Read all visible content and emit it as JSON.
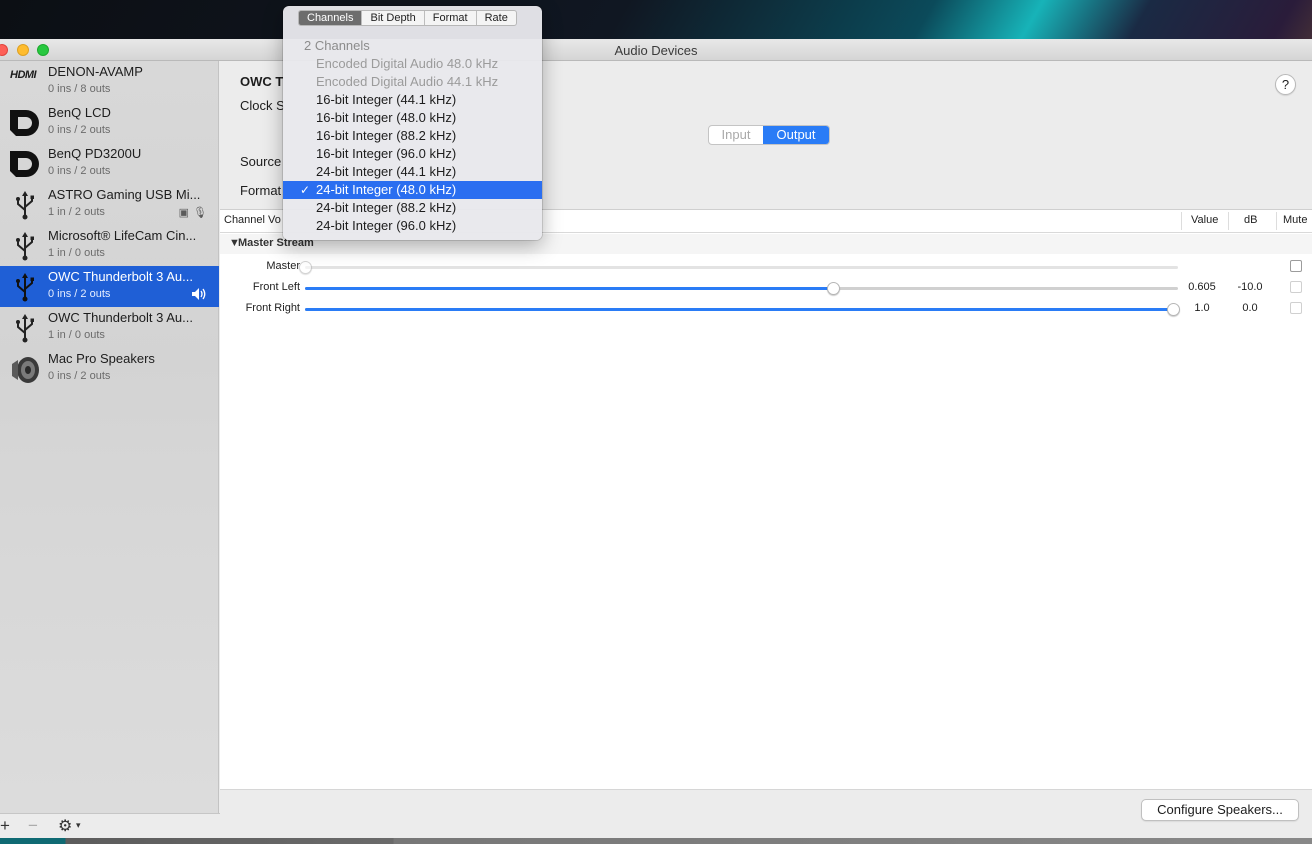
{
  "window": {
    "title": "Audio Devices"
  },
  "devices": [
    {
      "name": "DENON-AVAMP",
      "io": "0 ins / 8 outs",
      "icon": "hdmi-icon",
      "icon_text": "HDMI"
    },
    {
      "name": "BenQ LCD",
      "io": "0 ins / 2 outs",
      "icon": "displayport-icon"
    },
    {
      "name": "BenQ PD3200U",
      "io": "0 ins / 2 outs",
      "icon": "displayport-icon"
    },
    {
      "name": "ASTRO Gaming USB Mi...",
      "io": "1 in / 2 outs",
      "icon": "usb-icon",
      "badges": [
        "screen-icon",
        "microphone-icon"
      ]
    },
    {
      "name": "Microsoft® LifeCam Cin...",
      "io": "1 in / 0 outs",
      "icon": "usb-icon"
    },
    {
      "name": "OWC Thunderbolt 3 Au...",
      "io": "0 ins / 2 outs",
      "icon": "usb-icon",
      "selected": true,
      "badges": [
        "speaker-icon"
      ]
    },
    {
      "name": "OWC Thunderbolt 3 Au...",
      "io": "1 in / 0 outs",
      "icon": "usb-icon"
    },
    {
      "name": "Mac Pro Speakers",
      "io": "0 ins / 2 outs",
      "icon": "speaker-device-icon"
    }
  ],
  "main": {
    "device_title": "OWC T",
    "clock_label": "Clock S",
    "source_label": "Source",
    "format_label": "Format",
    "help": "?",
    "segment": {
      "input": "Input",
      "output": "Output",
      "selected": "Output"
    }
  },
  "table": {
    "headers": {
      "channel": "Channel Vo",
      "value": "Value",
      "db": "dB",
      "mute": "Mute"
    },
    "group": "Master Stream",
    "channels": [
      {
        "name": "Master",
        "level": 0.0,
        "value": "",
        "db": "",
        "fill": false
      },
      {
        "name": "Front Left",
        "level": 0.605,
        "value": "0.605",
        "db": "-10.0",
        "fill": true
      },
      {
        "name": "Front Right",
        "level": 1.0,
        "value": "1.0",
        "db": "0.0",
        "fill": true
      }
    ]
  },
  "footer": {
    "configure_button": "Configure Speakers..."
  },
  "popup": {
    "tabs": [
      "Channels",
      "Bit Depth",
      "Format",
      "Rate"
    ],
    "active_tab": "Channels",
    "header": "2 Channels",
    "items": [
      {
        "label": "Encoded Digital Audio 48.0 kHz",
        "disabled": true
      },
      {
        "label": "Encoded Digital Audio 44.1 kHz",
        "disabled": true
      },
      {
        "label": "16-bit Integer (44.1 kHz)"
      },
      {
        "label": "16-bit Integer (48.0 kHz)"
      },
      {
        "label": "16-bit Integer (88.2 kHz)"
      },
      {
        "label": "16-bit Integer (96.0 kHz)"
      },
      {
        "label": "24-bit Integer (44.1 kHz)"
      },
      {
        "label": "24-bit Integer (48.0 kHz)",
        "selected": true
      },
      {
        "label": "24-bit Integer (88.2 kHz)"
      },
      {
        "label": "24-bit Integer (96.0 kHz)"
      }
    ],
    "check_glyph": "✓"
  },
  "colors": {
    "accent": "#2a7cf6",
    "selection": "#1f5fd6"
  }
}
